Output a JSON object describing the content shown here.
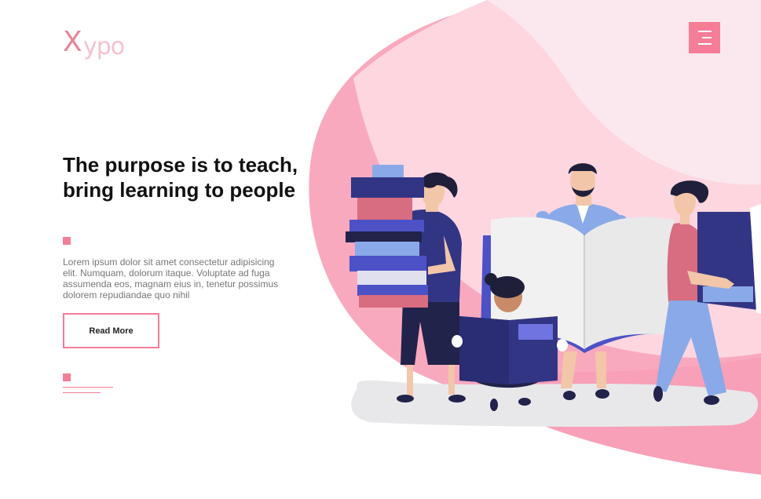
{
  "brand": {
    "logo_mark": "X",
    "logo_text": "ypo"
  },
  "header": {
    "menu_icon": "hamburger-menu-icon"
  },
  "hero": {
    "title": "The purpose is to teach, bring learning to people",
    "description": "Lorem ipsum dolor sit amet consectetur adipisicing elit. Numquam, dolorum itaque. Voluptate ad fuga assumenda eos, magnam eius in, tenetur possimus dolorem repudiandae quo nihil",
    "cta_label": "Read More"
  },
  "colors": {
    "accent": "#f57d98",
    "blob_light": "#fdd6e0",
    "blob_mid": "#f9a9be",
    "blob_pale": "#fbe8ee",
    "navy": "#323584",
    "indigo": "#4c51c6"
  }
}
